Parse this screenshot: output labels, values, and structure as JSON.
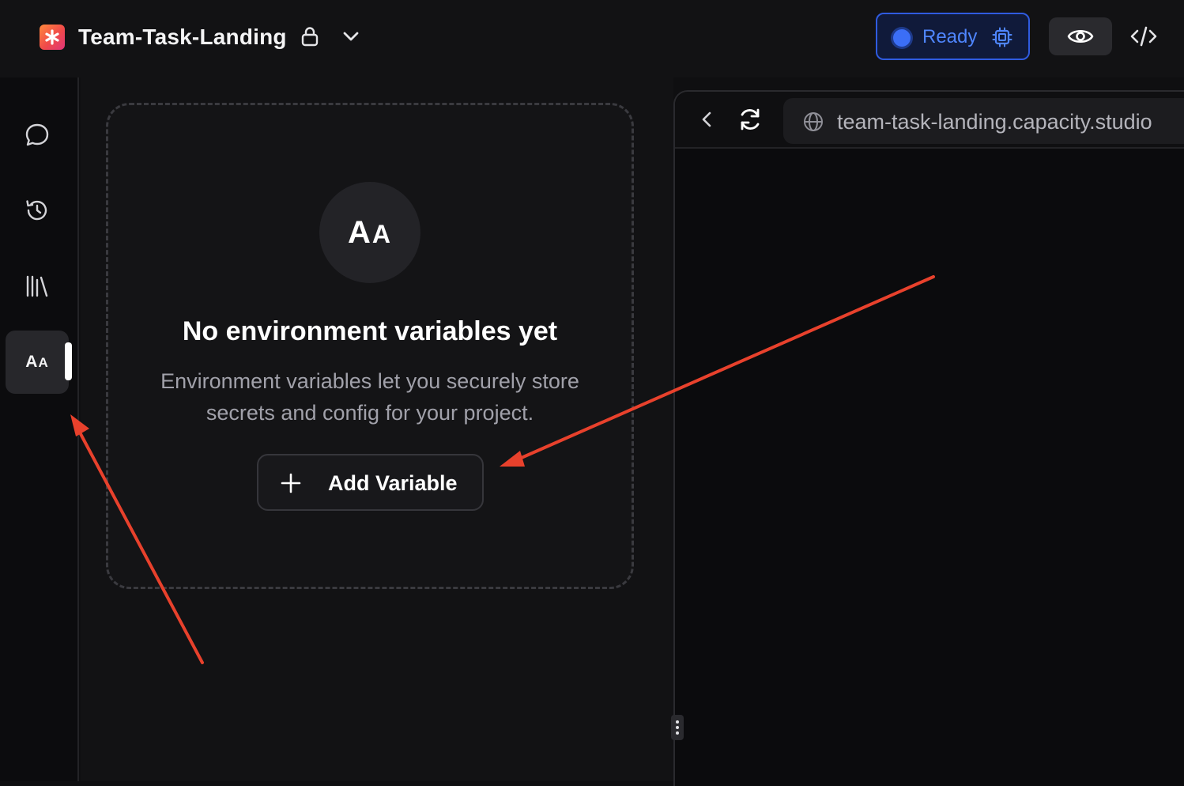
{
  "header": {
    "project_name": "Team-Task-Landing",
    "status_label": "Ready",
    "status_color": "#4f86ff",
    "icons": [
      "app-logo-icon",
      "lock-icon",
      "chevron-down-icon",
      "cpu-icon",
      "eye-icon",
      "code-icon"
    ]
  },
  "sidebar": {
    "items": [
      {
        "name": "chat",
        "icon": "chat-bubble-icon"
      },
      {
        "name": "history",
        "icon": "history-icon"
      },
      {
        "name": "library",
        "icon": "library-icon"
      },
      {
        "name": "environment-variables",
        "icon": "aa-icon",
        "label": "Aa",
        "active": true
      }
    ]
  },
  "empty_state": {
    "icon_label": "Aa",
    "title": "No environment variables yet",
    "description_line1": "Environment variables let you securely store",
    "description_line2": "secrets and config for your project.",
    "add_button_label": "Add Variable"
  },
  "preview": {
    "url": "team-task-landing.capacity.studio"
  },
  "annotation_color": "#e8412c"
}
